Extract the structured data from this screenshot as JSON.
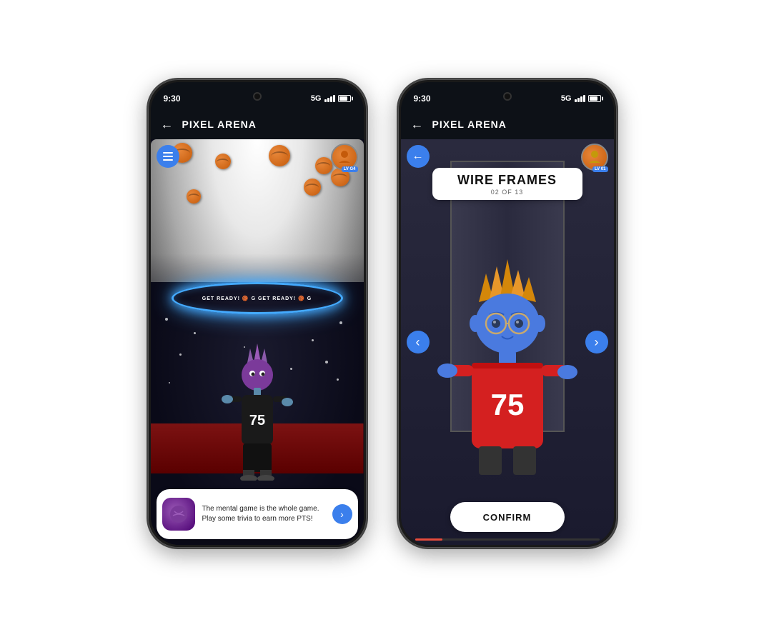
{
  "page": {
    "background": "#ffffff"
  },
  "phone1": {
    "status": {
      "time": "9:30",
      "signal": "5G",
      "battery": "full"
    },
    "appBar": {
      "title": "PIXEL ARENA",
      "backLabel": "←"
    },
    "levelBadge": "LV G4",
    "arena": {
      "ringText": "GET READY! 🏀 G GET READY! 🏀 G"
    },
    "chatBubble": {
      "text": "The mental game is the whole game. Play some trivia to earn more PTS!",
      "arrowLabel": "›"
    },
    "menuLabel": "☰"
  },
  "phone2": {
    "status": {
      "time": "9:30",
      "signal": "5G",
      "battery": "full"
    },
    "appBar": {
      "title": "PIXEL ARENA",
      "backLabel": "←"
    },
    "levelBadge": "LV 01",
    "itemHeader": {
      "title": "WIRE FRAMES",
      "subtitle": "02 OF 13"
    },
    "navLeft": "‹",
    "navRight": "›",
    "confirmButton": "CONFIRM",
    "progressPercent": 15
  }
}
